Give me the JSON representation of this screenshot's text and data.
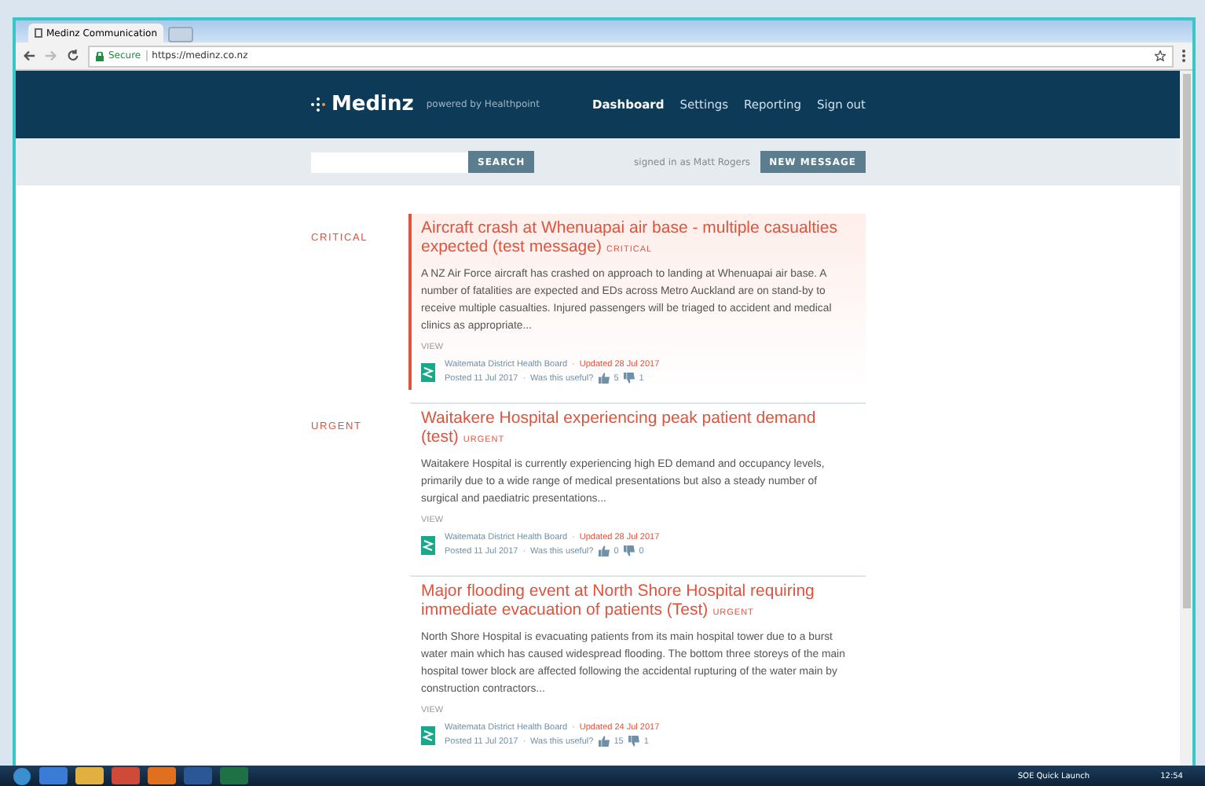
{
  "browser": {
    "tab_title": "Medinz Communication",
    "secure_label": "Secure",
    "url": "https://medinz.co.nz"
  },
  "header": {
    "logo": "Medinz",
    "tagline": "powered by Healthpoint",
    "nav": [
      {
        "label": "Dashboard",
        "selected": true
      },
      {
        "label": "Settings",
        "selected": false
      },
      {
        "label": "Reporting",
        "selected": false
      },
      {
        "label": "Sign out",
        "selected": false
      }
    ]
  },
  "toolbar": {
    "search_button": "SEARCH",
    "signed_in": "signed in as Matt Rogers",
    "new_message": "NEW MESSAGE"
  },
  "messages": [
    {
      "kind": "critical",
      "side_label": "CRITICAL",
      "title": "Aircraft crash at Whenuapai air base - multiple casualties expected (test message)",
      "badge": "CRITICAL",
      "body": "A NZ Air Force aircraft has crashed on approach to landing at Whenuapai air base. A number of fatalities are expected and EDs across Metro Auckland are on stand-by to receive multiple casualties. Injured passengers will be triaged to accident and medical clinics as appropriate...",
      "view": "VIEW",
      "org": "Waitemata District Health Board",
      "updated": "Updated 28 Jul 2017",
      "posted": "Posted 11 Jul 2017",
      "useful": "Was this useful?",
      "up": "5",
      "down": "1"
    },
    {
      "kind": "urgent",
      "side_label": "URGENT",
      "title": "Waitakere Hospital experiencing peak patient demand (test)",
      "badge": "URGENT",
      "body": "Waitakere Hospital is currently experiencing high ED demand and occupancy levels, primarily due to a wide range of medical presentations but also a steady number of surgical and paediatric presentations...",
      "view": "VIEW",
      "org": "Waitemata District Health Board",
      "updated": "Updated 28 Jul 2017",
      "posted": "Posted 11 Jul 2017",
      "useful": "Was this useful?",
      "up": "0",
      "down": "0"
    },
    {
      "kind": "urgent",
      "title": "Major flooding event at North Shore Hospital requiring immediate evacuation of patients (Test)",
      "badge": "URGENT",
      "body": "North Shore Hospital is evacuating patients from its main hospital tower due to a burst water main which has caused widespread flooding. The bottom three storeys of the main hospital tower block are affected following the accidental rupturing of the water main by construction contractors...",
      "view": "VIEW",
      "org": "Waitemata District Health Board",
      "updated": "Updated 24 Jul 2017",
      "posted": "Posted 11 Jul 2017",
      "useful": "Was this useful?",
      "up": "15",
      "down": "1"
    }
  ],
  "separator": "·",
  "taskbar": {
    "quick_launch": "SOE Quick Launch",
    "clock": "12:54"
  }
}
